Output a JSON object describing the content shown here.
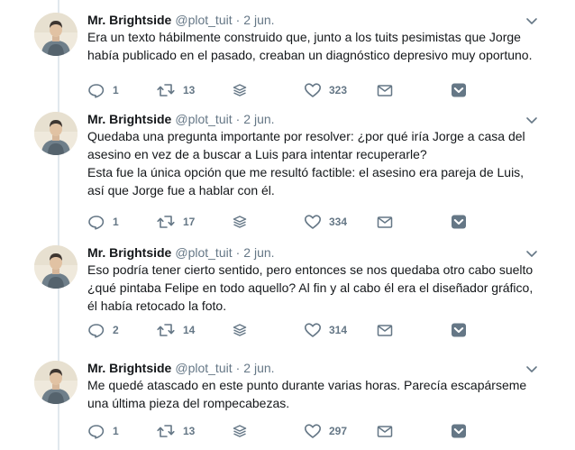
{
  "tweets": [
    {
      "author": "Mr. Brightside",
      "handle": "@plot_tuit",
      "sep": "·",
      "time": "2 jun.",
      "lines": [
        "Era un texto hábilmente construido que, junto a los tuits pesimistas que Jorge",
        "había publicado en el pasado, creaban un diagnóstico depresivo muy oportuno."
      ],
      "replies": "1",
      "retweets": "13",
      "likes": "323"
    },
    {
      "author": "Mr. Brightside",
      "handle": "@plot_tuit",
      "sep": "·",
      "time": "2 jun.",
      "lines": [
        "Quedaba una pregunta importante por resolver: ¿por qué iría Jorge a casa del",
        "asesino en vez de a buscar a Luis para intentar recuperarle?",
        "Esta fue la única opción que me resultó factible: el asesino era pareja de Luis,",
        "así que Jorge fue a hablar con él."
      ],
      "replies": "1",
      "retweets": "17",
      "likes": "334"
    },
    {
      "author": "Mr. Brightside",
      "handle": "@plot_tuit",
      "sep": "·",
      "time": "2 jun.",
      "lines": [
        "Eso podría tener cierto sentido, pero entonces se nos quedaba otro cabo suelto",
        "¿qué pintaba Felipe en todo aquello? Al fin y al cabo él era el diseñador gráfico,",
        "él había retocado la foto."
      ],
      "replies": "2",
      "retweets": "14",
      "likes": "314"
    },
    {
      "author": "Mr. Brightside",
      "handle": "@plot_tuit",
      "sep": "·",
      "time": "2 jun.",
      "lines": [
        "Me quedé atascado en este punto durante varias horas. Parecía escapárseme",
        "una última pieza del rompecabezas."
      ],
      "replies": "1",
      "retweets": "13",
      "likes": "297"
    }
  ],
  "colors": {
    "text": "#14171a",
    "muted": "#657786",
    "icon": "#657786",
    "divider": "#e1e8ed"
  },
  "icons": {
    "reply": "reply-icon",
    "retweet": "retweet-icon",
    "stack": "stack-icon",
    "like": "heart-icon",
    "dm": "envelope-icon",
    "caret": "caret-down-icon"
  }
}
